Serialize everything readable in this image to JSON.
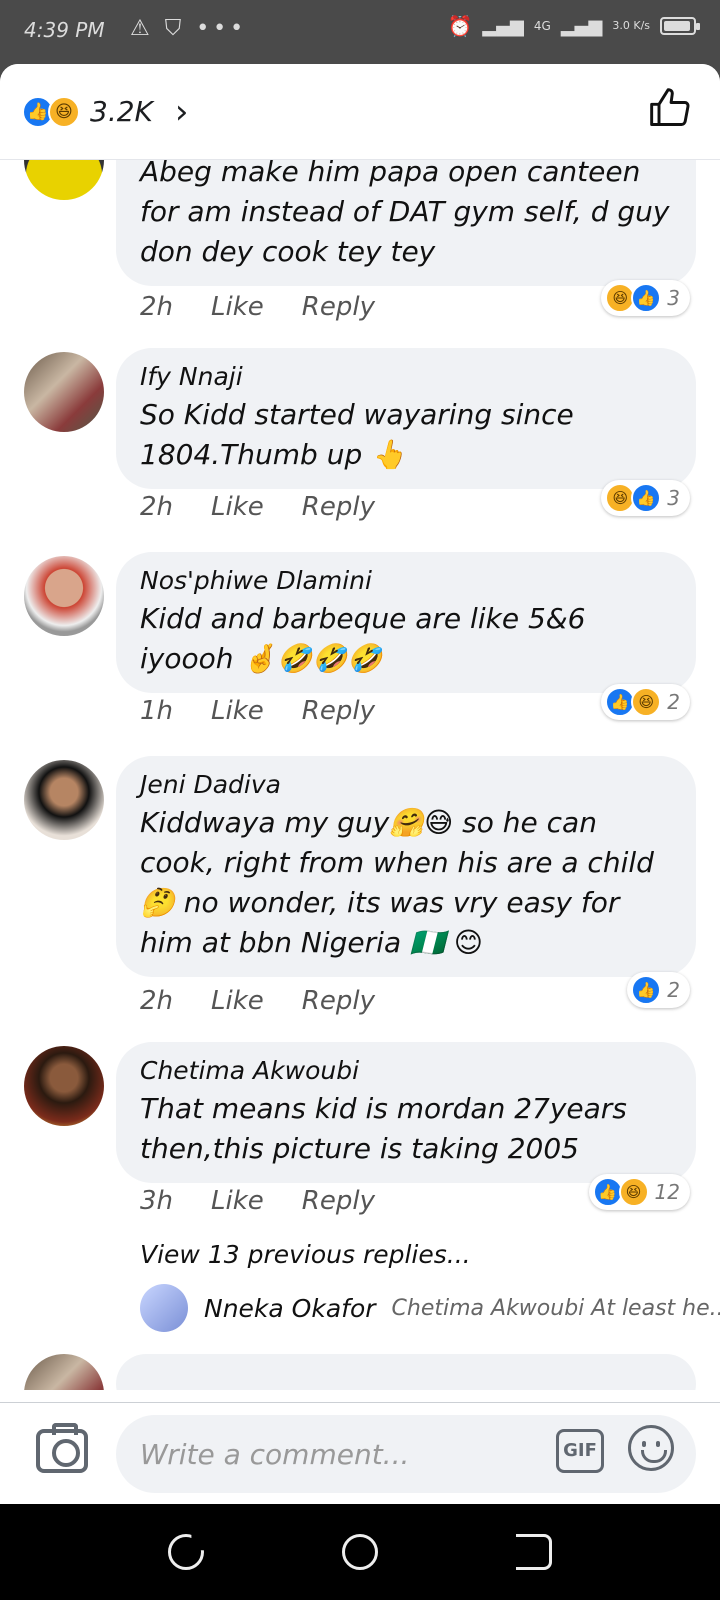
{
  "status_bar": {
    "time": "4:39 PM",
    "icons_left": "⚠ ⛉ •••",
    "network": "4G",
    "speed": "3.0 K/s"
  },
  "header": {
    "reaction_count": "3.2K",
    "chevron": "›",
    "thumb": "👍"
  },
  "comments": [
    {
      "author": "",
      "text": "Abeg make him papa open canteen for am instead of DAT gym self, d guy don dey cook tey tey",
      "time": "2h",
      "like": "Like",
      "reply": "Reply",
      "reactions": [
        "haha",
        "like"
      ],
      "reaction_count": "3"
    },
    {
      "author": "Ify Nnaji",
      "text": "So Kidd started wayaring since 1804.Thumb up 👆",
      "time": "2h",
      "like": "Like",
      "reply": "Reply",
      "reactions": [
        "haha",
        "like"
      ],
      "reaction_count": "3"
    },
    {
      "author": "Nos'phiwe Dlamini",
      "text": "Kidd and barbeque are like 5&6 iyoooh 🤞🤣🤣🤣",
      "time": "1h",
      "like": "Like",
      "reply": "Reply",
      "reactions": [
        "like",
        "haha"
      ],
      "reaction_count": "2"
    },
    {
      "author": "Jeni Dadiva",
      "text": "Kiddwaya my guy🤗😅 so he  can cook, right from when his are a child🤔 no wonder, its was vry easy for him at bbn Nigeria 🇳🇬 😊",
      "time": "2h",
      "like": "Like",
      "reply": "Reply",
      "reactions": [
        "like"
      ],
      "reaction_count": "2"
    },
    {
      "author": "Chetima Akwoubi",
      "text": "That means kid is mordan 27years then,this picture is taking 2005",
      "time": "3h",
      "like": "Like",
      "reply": "Reply",
      "reactions": [
        "like",
        "haha"
      ],
      "reaction_count": "12"
    }
  ],
  "view_previous": "View 13 previous replies...",
  "reply_preview": {
    "name": "Nneka Okafor",
    "snippet": "Chetima Akwoubi At least he..."
  },
  "composer": {
    "placeholder": "Write a comment...",
    "gif_label": "GIF"
  },
  "colors": {
    "like_blue": "#1877f2",
    "haha_yellow": "#f7b125",
    "bubble_bg": "#f0f2f5"
  }
}
